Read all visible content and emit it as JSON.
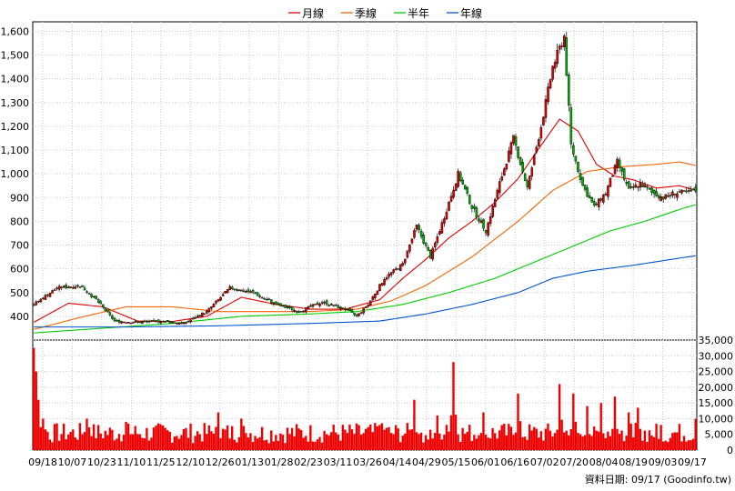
{
  "chart_data": [
    {
      "type": "candlestick",
      "panel": "price",
      "y_ticks": [
        "400",
        "500",
        "600",
        "700",
        "800",
        "900",
        "1,000",
        "1,100",
        "1,200",
        "1,300",
        "1,400",
        "1,500",
        "1,600"
      ],
      "ylim": [
        300,
        1640
      ],
      "legend": {
        "placement": "top-center",
        "items": [
          {
            "name": "月線",
            "color": "#dd0000"
          },
          {
            "name": "季線",
            "color": "#ee6600"
          },
          {
            "name": "半年",
            "color": "#00cc00"
          },
          {
            "name": "年線",
            "color": "#0055cc"
          }
        ]
      },
      "grid": true,
      "up_color": "#dd0000",
      "down_color": "#00aa00",
      "key_prices": [
        [
          0,
          450
        ],
        [
          10,
          520
        ],
        [
          20,
          530
        ],
        [
          27,
          470
        ],
        [
          35,
          380
        ],
        [
          45,
          375
        ],
        [
          55,
          380
        ],
        [
          65,
          370
        ],
        [
          75,
          420
        ],
        [
          85,
          520
        ],
        [
          95,
          500
        ],
        [
          105,
          450
        ],
        [
          115,
          420
        ],
        [
          125,
          460
        ],
        [
          135,
          430
        ],
        [
          140,
          400
        ],
        [
          145,
          450
        ],
        [
          152,
          560
        ],
        [
          160,
          620
        ],
        [
          166,
          780
        ],
        [
          172,
          650
        ],
        [
          178,
          820
        ],
        [
          184,
          1000
        ],
        [
          190,
          860
        ],
        [
          196,
          760
        ],
        [
          202,
          960
        ],
        [
          208,
          1150
        ],
        [
          214,
          940
        ],
        [
          220,
          1200
        ],
        [
          225,
          1450
        ],
        [
          230,
          1580
        ],
        [
          233,
          1120
        ],
        [
          238,
          950
        ],
        [
          243,
          860
        ],
        [
          248,
          920
        ],
        [
          253,
          1050
        ],
        [
          258,
          930
        ],
        [
          263,
          960
        ],
        [
          268,
          920
        ],
        [
          273,
          900
        ],
        [
          278,
          920
        ],
        [
          283,
          920
        ],
        [
          287,
          930
        ]
      ],
      "moving_averages": [
        {
          "name": "月線",
          "points": [
            [
              0,
              375
            ],
            [
              15,
              455
            ],
            [
              30,
              440
            ],
            [
              45,
              380
            ],
            [
              60,
              378
            ],
            [
              75,
              400
            ],
            [
              90,
              480
            ],
            [
              105,
              450
            ],
            [
              120,
              430
            ],
            [
              135,
              430
            ],
            [
              150,
              470
            ],
            [
              160,
              560
            ],
            [
              170,
              640
            ],
            [
              180,
              730
            ],
            [
              190,
              800
            ],
            [
              200,
              880
            ],
            [
              210,
              980
            ],
            [
              220,
              1120
            ],
            [
              228,
              1230
            ],
            [
              236,
              1180
            ],
            [
              244,
              1040
            ],
            [
              252,
              990
            ],
            [
              260,
              975
            ],
            [
              270,
              940
            ],
            [
              280,
              950
            ],
            [
              287,
              930
            ]
          ]
        },
        {
          "name": "季線",
          "points": [
            [
              0,
              345
            ],
            [
              20,
              395
            ],
            [
              40,
              440
            ],
            [
              60,
              440
            ],
            [
              80,
              420
            ],
            [
              100,
              420
            ],
            [
              120,
              420
            ],
            [
              140,
              430
            ],
            [
              155,
              465
            ],
            [
              170,
              530
            ],
            [
              190,
              650
            ],
            [
              210,
              800
            ],
            [
              225,
              930
            ],
            [
              240,
              1010
            ],
            [
              255,
              1030
            ],
            [
              270,
              1040
            ],
            [
              280,
              1050
            ],
            [
              287,
              1035
            ]
          ]
        },
        {
          "name": "半年",
          "points": [
            [
              0,
              330
            ],
            [
              30,
              350
            ],
            [
              60,
              370
            ],
            [
              90,
              400
            ],
            [
              120,
              410
            ],
            [
              140,
              420
            ],
            [
              160,
              450
            ],
            [
              180,
              500
            ],
            [
              200,
              560
            ],
            [
              220,
              640
            ],
            [
              235,
              700
            ],
            [
              250,
              760
            ],
            [
              265,
              800
            ],
            [
              280,
              850
            ],
            [
              287,
              870
            ]
          ]
        },
        {
          "name": "年線",
          "points": [
            [
              0,
              355
            ],
            [
              40,
              355
            ],
            [
              80,
              360
            ],
            [
              120,
              370
            ],
            [
              150,
              380
            ],
            [
              170,
              410
            ],
            [
              190,
              450
            ],
            [
              210,
              500
            ],
            [
              225,
              560
            ],
            [
              240,
              590
            ],
            [
              260,
              615
            ],
            [
              280,
              645
            ],
            [
              287,
              655
            ]
          ]
        }
      ]
    },
    {
      "type": "bar",
      "panel": "volume",
      "y_ticks": [
        "0",
        "5,000",
        "10,000",
        "15,000",
        "20,000",
        "25,000",
        "30,000",
        "35,000"
      ],
      "ylim": [
        0,
        35000
      ],
      "color": "#ee0000",
      "spikes": [
        [
          0,
          32500
        ],
        [
          1,
          25000
        ],
        [
          2,
          16000
        ],
        [
          4,
          10000
        ],
        [
          23,
          10000
        ],
        [
          40,
          9000
        ],
        [
          80,
          12000
        ],
        [
          90,
          10000
        ],
        [
          150,
          8000
        ],
        [
          165,
          16000
        ],
        [
          175,
          11000
        ],
        [
          182,
          28000
        ],
        [
          195,
          12000
        ],
        [
          210,
          18000
        ],
        [
          228,
          21000
        ],
        [
          234,
          18000
        ],
        [
          240,
          14000
        ],
        [
          246,
          15000
        ],
        [
          252,
          17000
        ],
        [
          258,
          12000
        ],
        [
          262,
          13500
        ],
        [
          272,
          8000
        ],
        [
          287,
          10000
        ]
      ],
      "x_labels": [
        "09/18",
        "10/07",
        "10/23",
        "11/10",
        "11/25",
        "12/10",
        "12/26",
        "01/13",
        "01/28",
        "02/23",
        "03/11",
        "03/26",
        "04/14",
        "04/29",
        "05/15",
        "06/01",
        "06/16",
        "07/02",
        "07/20",
        "08/04",
        "08/19",
        "09/03",
        "09/17"
      ]
    }
  ],
  "source": "資料日期: 09/17  (Goodinfo.tw)"
}
